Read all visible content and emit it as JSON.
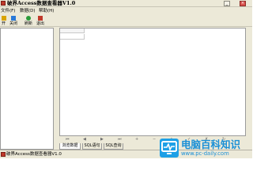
{
  "window": {
    "title": "破界Access数据查看器V1.0",
    "minimize_glyph": "_",
    "close_glyph": "×"
  },
  "menu": [
    {
      "label": "文件(F)"
    },
    {
      "label": "数据(D)"
    },
    {
      "label": "帮助(H)"
    }
  ],
  "toolbar": [
    {
      "label": "开",
      "icon": "open-folder-icon",
      "color": "#d9a400"
    },
    {
      "label": "关闭",
      "icon": "close-file-icon",
      "color": "#2b7ad8"
    },
    {
      "label": "刷新",
      "icon": "refresh-icon",
      "color": "#2b9b3a"
    },
    {
      "label": "退出",
      "icon": "exit-icon",
      "color": "#c0392b"
    }
  ],
  "grid": {
    "header": "",
    "cell": ""
  },
  "navigator": [
    "⏮",
    "◀",
    "▶",
    "⏭",
    "+",
    "−",
    "▲",
    "✓",
    "✗",
    "↻"
  ],
  "tabs": [
    {
      "label": "浏览数据",
      "active": true
    },
    {
      "label": "SQL语句",
      "active": false
    },
    {
      "label": "SQL查询",
      "active": false
    }
  ],
  "status": {
    "text": "破界Access数据查看器V1.0"
  },
  "watermark": {
    "title": "电脑百科知识",
    "url": "www.pc-daily.com",
    "color": "#1a8fd6"
  }
}
